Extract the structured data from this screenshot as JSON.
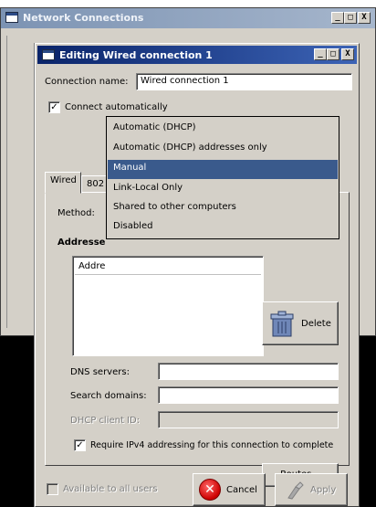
{
  "back_window": {
    "title": "Network Connections",
    "controls": [
      "_",
      "□",
      "X"
    ]
  },
  "dialog": {
    "title": "Editing Wired connection 1",
    "controls": [
      "_",
      "□",
      "X"
    ],
    "connection_name_label": "Connection name:",
    "connection_name_value": "Wired connection 1",
    "connect_automatically_label": "Connect automatically",
    "connect_automatically_checked": true,
    "tabs": [
      "Wired",
      "802"
    ],
    "method_label": "Method:",
    "addresses_label": "Addresse",
    "addresses_column": "Addre",
    "delete_label": "Delete",
    "dns_label": "DNS servers:",
    "dns_value": "",
    "search_label": "Search domains:",
    "search_value": "",
    "dhcp_label": "DHCP client ID:",
    "dhcp_value": "",
    "require_ipv4_label": "Require IPv4 addressing for this connection to complete",
    "require_ipv4_checked": true,
    "routes_label": "Routes...",
    "available_label": "Available to all users",
    "cancel_label": "Cancel",
    "apply_label": "Apply"
  },
  "method_dropdown": {
    "options": [
      "Automatic (DHCP)",
      "Automatic (DHCP) addresses only",
      "Manual",
      "Link-Local Only",
      "Shared to other computers",
      "Disabled"
    ],
    "selected": "Manual"
  },
  "colors": {
    "window_bg": "#d4d0c8",
    "active_title": "#0a246a",
    "inactive_title": "#7c93b3",
    "selection": "#3a5a8c"
  }
}
